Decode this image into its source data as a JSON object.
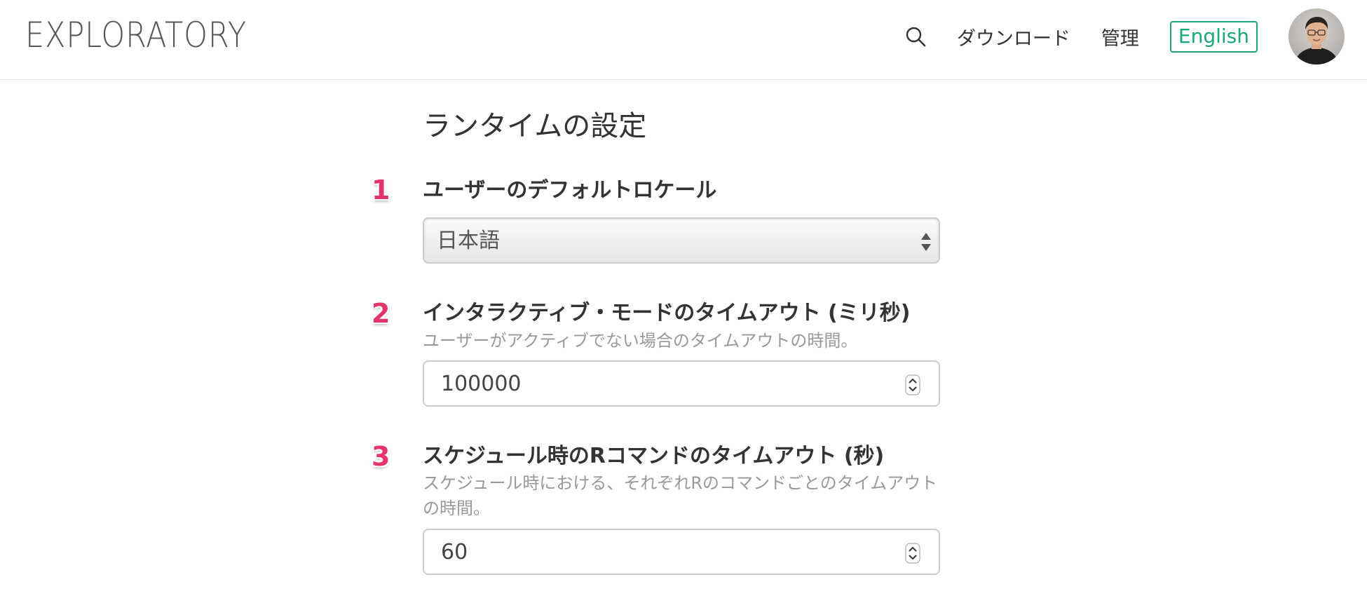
{
  "header": {
    "logo": "EXPLORATORY",
    "nav": {
      "download": "ダウンロード",
      "admin": "管理",
      "language_button": "English"
    },
    "icons": [
      "search-icon",
      "user-avatar"
    ],
    "colors": {
      "accent": "#19a974",
      "badge": "#e5336b"
    }
  },
  "page": {
    "title": "ランタイムの設定"
  },
  "settings": [
    {
      "number": "1",
      "label": "ユーザーのデフォルトロケール",
      "type": "select",
      "value": "日本語"
    },
    {
      "number": "2",
      "label": "インタラクティブ・モードのタイムアウト (ミリ秒)",
      "description": "ユーザーがアクティブでない場合のタイムアウトの時間。",
      "type": "number",
      "value": "100000"
    },
    {
      "number": "3",
      "label": "スケジュール時のRコマンドのタイムアウト (秒)",
      "description": "スケジュール時における、それぞれRのコマンドごとのタイムアウトの時間。",
      "type": "number",
      "value": "60"
    }
  ]
}
